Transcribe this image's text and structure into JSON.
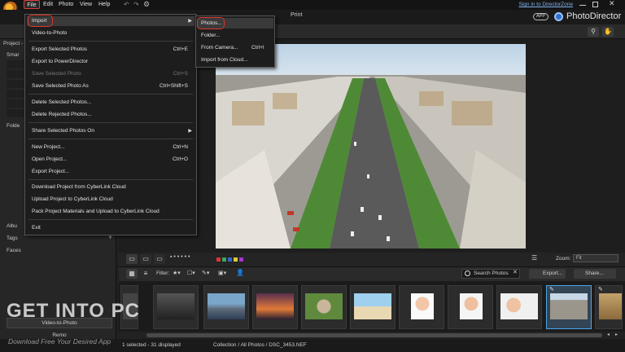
{
  "menubar": {
    "file": "File",
    "edit": "Edit",
    "photo": "Photo",
    "view": "View",
    "help": "Help"
  },
  "header": {
    "signin": "Sign in to DirectorZone",
    "print": "Print",
    "app_badge": "APP",
    "brand": "PhotoDirector"
  },
  "file_menu": {
    "items": [
      {
        "label": "Import",
        "shortcut": "",
        "submenu": true,
        "disabled": false
      },
      {
        "label": "Video-to-Photo",
        "shortcut": "",
        "disabled": false
      },
      {
        "label": "Export Selected Photos",
        "shortcut": "Ctrl+E",
        "disabled": false
      },
      {
        "label": "Export to PowerDirector",
        "shortcut": "",
        "disabled": false
      },
      {
        "label": "Save Selected Photo",
        "shortcut": "Ctrl+S",
        "disabled": true
      },
      {
        "label": "Save Selected Photo As",
        "shortcut": "Ctrl+Shift+S",
        "disabled": false
      },
      {
        "label": "Delete Selected Photos...",
        "shortcut": "",
        "disabled": false
      },
      {
        "label": "Delete Rejected Photos...",
        "shortcut": "",
        "disabled": false
      },
      {
        "label": "Share Selected Photos On",
        "shortcut": "",
        "submenu": true,
        "disabled": false
      },
      {
        "label": "New Project...",
        "shortcut": "Ctrl+N",
        "disabled": false
      },
      {
        "label": "Open Project...",
        "shortcut": "Ctrl+O",
        "disabled": false
      },
      {
        "label": "Export Project...",
        "shortcut": "",
        "disabled": false
      },
      {
        "label": "Download Project from CyberLink Cloud",
        "shortcut": "",
        "disabled": false
      },
      {
        "label": "Upload Project to CyberLink Cloud",
        "shortcut": "",
        "disabled": false
      },
      {
        "label": "Pack Project Materials and Upload to CyberLink Cloud",
        "shortcut": "",
        "disabled": false
      },
      {
        "label": "Exit",
        "shortcut": "",
        "disabled": false
      }
    ]
  },
  "import_submenu": {
    "items": [
      {
        "label": "Photos...",
        "shortcut": ""
      },
      {
        "label": "Folder...",
        "shortcut": ""
      },
      {
        "label": "From Camera...",
        "shortcut": "Ctrl+I"
      },
      {
        "label": "Import from Cloud...",
        "shortcut": ""
      }
    ]
  },
  "left_panel": {
    "project": "Project -",
    "smart": "Smar",
    "folders": "Folde",
    "albums": "Albu",
    "tags": "Tags",
    "faces": "Faces",
    "video_to_photo": "Video-to-Photo",
    "remove": "Remo"
  },
  "viewer": {
    "zoom_label": "Zoom:",
    "zoom_value": "Fit"
  },
  "filter_bar": {
    "filter_label": "Filter:",
    "search_label": "Search Photos",
    "export_label": "Export...",
    "share_label": "Share..."
  },
  "status": {
    "selection": "1 selected - 31 displayed",
    "path": "Collection / All Photos / DSC_3453.NEF"
  },
  "watermark": {
    "title": "GET INTO PC",
    "subtitle": "Download Free Your Desired App"
  },
  "colors": {
    "accent_red": "#e0362e",
    "selection_blue": "#4aa8e8",
    "menu_bg": "#1d1d1d"
  }
}
